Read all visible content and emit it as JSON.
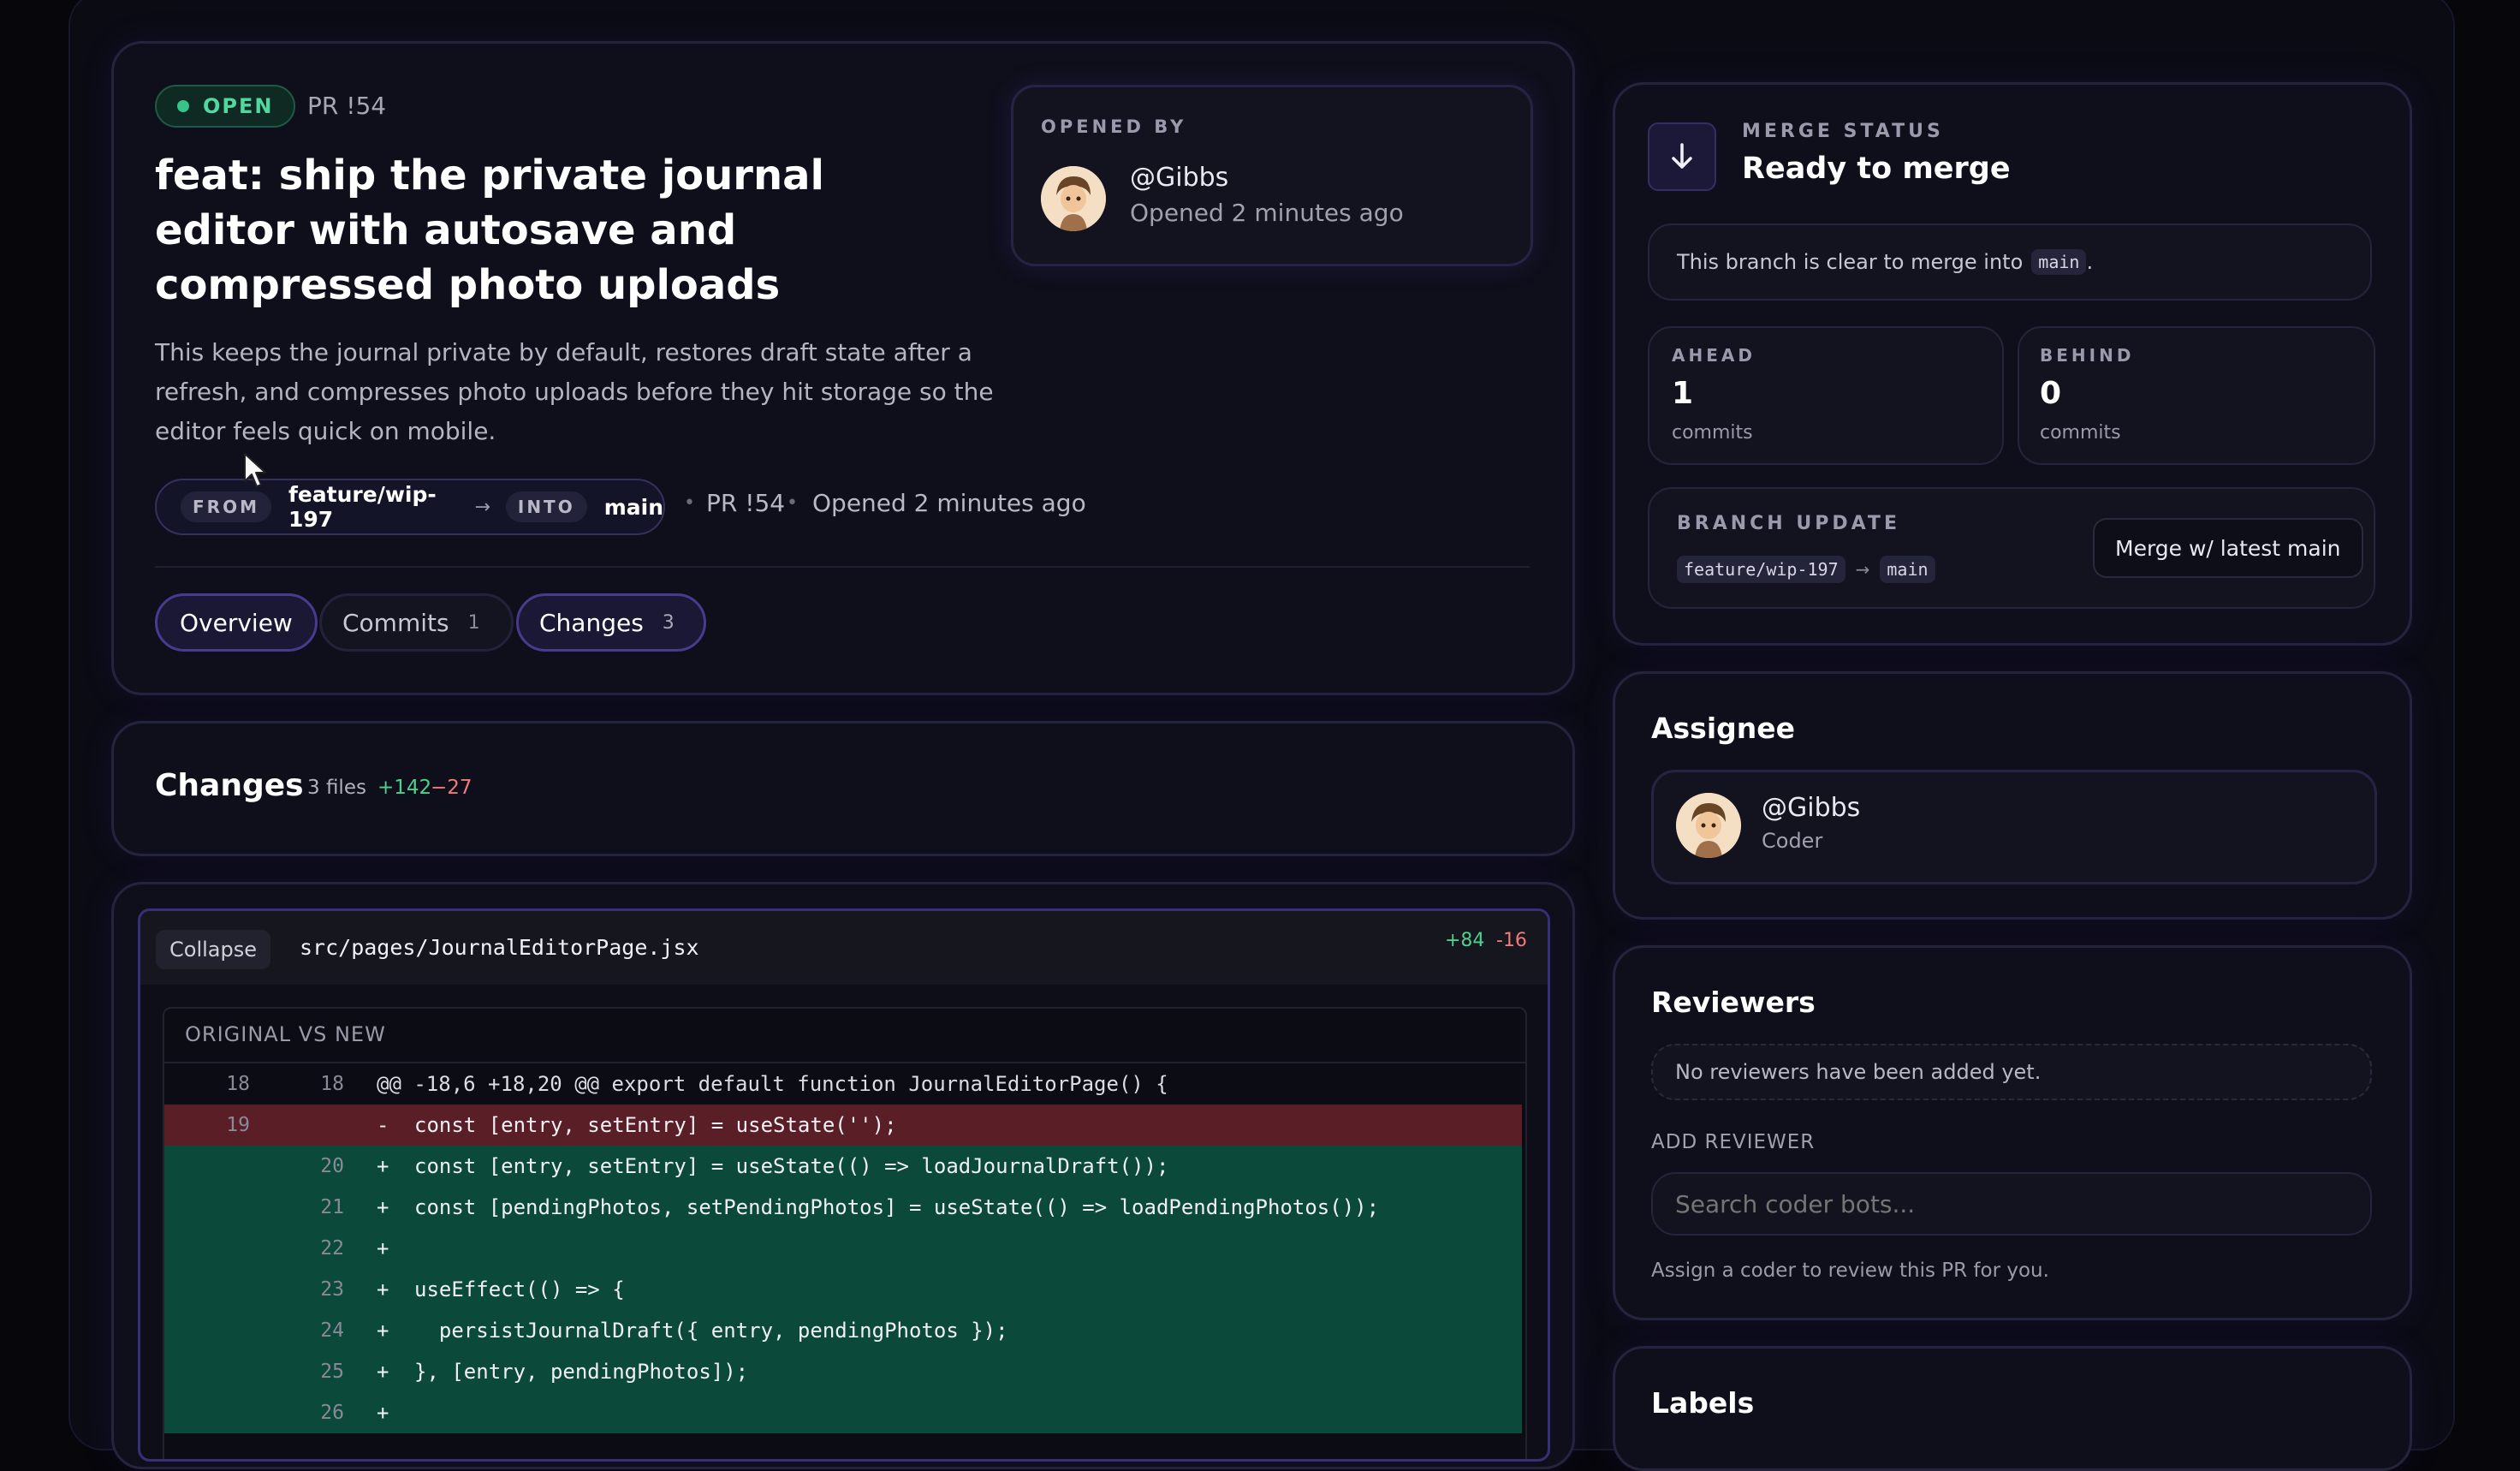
{
  "pr": {
    "status": "OPEN",
    "id": "PR !54",
    "title_line1": "feat: ship the private journal",
    "title_line2": "editor with autosave and",
    "title_line3": "compressed photo uploads",
    "desc_line1": "This keeps the journal private by default, restores draft state after a",
    "desc_line2": "refresh, and compresses photo uploads before they hit storage so the",
    "desc_line3": "editor feels quick on mobile.",
    "from_label": "FROM",
    "from_branch": "feature/wip-197",
    "arrow": "→",
    "into_label": "INTO",
    "into_branch": "main",
    "meta_id": "PR !54",
    "meta_opened": "Opened 2 minutes ago",
    "dot": "•"
  },
  "opened_by": {
    "label": "OPENED BY",
    "user": "@Gibbs",
    "time": "Opened 2 minutes ago"
  },
  "tabs": [
    {
      "label": "Overview",
      "count": ""
    },
    {
      "label": "Commits",
      "count": "1"
    },
    {
      "label": "Changes",
      "count": "3"
    }
  ],
  "changes": {
    "title": "Changes",
    "files": "3 files",
    "added": "+142",
    "removed": "−27"
  },
  "file": {
    "collapse_label": "Collapse",
    "path": "src/pages/JournalEditorPage.jsx",
    "added": "+84",
    "removed": "-16",
    "view_label": "ORIGINAL VS NEW",
    "lines": [
      {
        "old": "18",
        "new": "18",
        "type": "ctx",
        "sign": "",
        "text": "@@ -18,6 +18,20 @@ export default function JournalEditorPage() {"
      },
      {
        "old": "19",
        "new": "",
        "type": "del",
        "sign": "-",
        "text": "const [entry, setEntry] = useState('');"
      },
      {
        "old": "",
        "new": "20",
        "type": "add",
        "sign": "+",
        "text": "const [entry, setEntry] = useState(() => loadJournalDraft());"
      },
      {
        "old": "",
        "new": "21",
        "type": "add",
        "sign": "+",
        "text": "const [pendingPhotos, setPendingPhotos] = useState(() => loadPendingPhotos());"
      },
      {
        "old": "",
        "new": "22",
        "type": "add",
        "sign": "+",
        "text": ""
      },
      {
        "old": "",
        "new": "23",
        "type": "add",
        "sign": "+",
        "text": "useEffect(() => {"
      },
      {
        "old": "",
        "new": "24",
        "type": "add",
        "sign": "+",
        "text": "  persistJournalDraft({ entry, pendingPhotos });"
      },
      {
        "old": "",
        "new": "25",
        "type": "add",
        "sign": "+",
        "text": "}, [entry, pendingPhotos]);"
      },
      {
        "old": "",
        "new": "26",
        "type": "add",
        "sign": "+",
        "text": ""
      }
    ]
  },
  "merge": {
    "label": "MERGE STATUS",
    "status": "Ready to merge",
    "note_prefix": "This branch is clear to merge into",
    "note_branch": "main",
    "note_suffix": ".",
    "ahead_label": "AHEAD",
    "ahead_value": "1",
    "ahead_unit": "commits",
    "behind_label": "BEHIND",
    "behind_value": "0",
    "behind_unit": "commits",
    "update_label": "BRANCH UPDATE",
    "update_from": "feature/wip-197",
    "update_arrow": "→",
    "update_to": "main",
    "merge_button": "Merge w/ latest main"
  },
  "assignee": {
    "title": "Assignee",
    "user": "@Gibbs",
    "role": "Coder"
  },
  "reviewers": {
    "title": "Reviewers",
    "empty": "No reviewers have been added yet.",
    "add_label": "ADD REVIEWER",
    "search_placeholder": "Search coder bots...",
    "hint": "Assign a coder to review this PR for you."
  },
  "labels": {
    "title": "Labels"
  },
  "colors": {
    "open_green": "#35c58a",
    "added_green": "#4fd18b",
    "removed_red": "#f07a7a",
    "accent_purple": "#6f4bd8",
    "add_row_bg": "#0b4a3a",
    "del_row_bg": "#5a1e26"
  }
}
